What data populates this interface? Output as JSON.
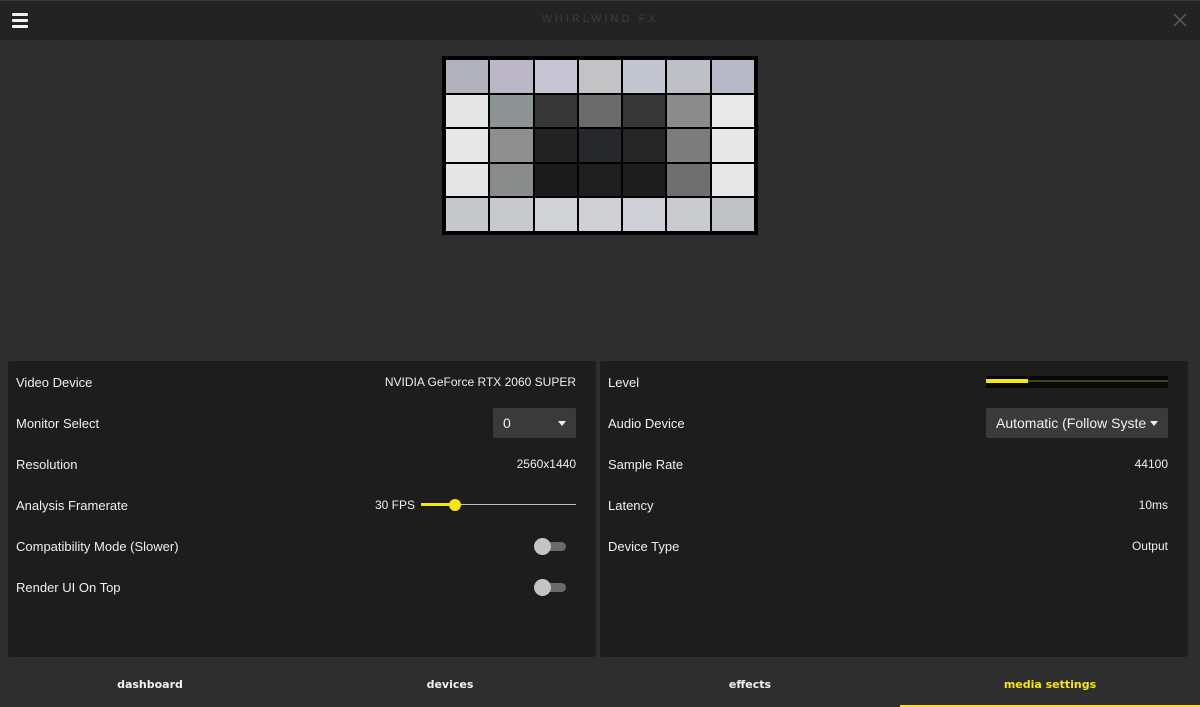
{
  "app": {
    "title": "WHIRLWIND FX"
  },
  "preview": {
    "cells": [
      "#b2b2bf",
      "#bbb7c6",
      "#c7c4d3",
      "#c3c3c6",
      "#c2c6d1",
      "#bfbfc8",
      "#b8b9c6",
      "#e6e6e6",
      "#8d9292",
      "#373737",
      "#6b6b6b",
      "#363636",
      "#8b8b8b",
      "#e9e9e9",
      "#e7e7e7",
      "#8f8f8f",
      "#232323",
      "#262829",
      "#262626",
      "#7c7c7c",
      "#e8e8e8",
      "#e5e5e5",
      "#8a8c8b",
      "#1b1b1b",
      "#1e1e1e",
      "#1d1d1d",
      "#6f6f6f",
      "#e7e7e7",
      "#c6c9cc",
      "#c8c9cd",
      "#d1d2d6",
      "#cfd0d4",
      "#ced0d6",
      "#c9cbcf",
      "#bfc2c5"
    ]
  },
  "video": {
    "device_label": "Video Device",
    "device_value": "NVIDIA GeForce RTX 2060 SUPER",
    "monitor_label": "Monitor Select",
    "monitor_value": "0",
    "resolution_label": "Resolution",
    "resolution_value": "2560x1440",
    "framerate_label": "Analysis Framerate",
    "framerate_value": "30 FPS",
    "framerate_fraction": 0.22,
    "compat_label": "Compatibility Mode (Slower)",
    "compat_on": false,
    "render_label": "Render UI On Top",
    "render_on": false
  },
  "audio": {
    "level_label": "Level",
    "level_fraction": 0.23,
    "device_label": "Audio Device",
    "device_value": "Automatic (Follow Syste",
    "sample_label": "Sample Rate",
    "sample_value": "44100",
    "latency_label": "Latency",
    "latency_value": "10ms",
    "type_label": "Device Type",
    "type_value": "Output"
  },
  "nav": {
    "dashboard": "dashboard",
    "devices": "devices",
    "effects": "effects",
    "media": "media settings",
    "active": "media settings"
  },
  "colors": {
    "accent": "#f6e60a"
  }
}
